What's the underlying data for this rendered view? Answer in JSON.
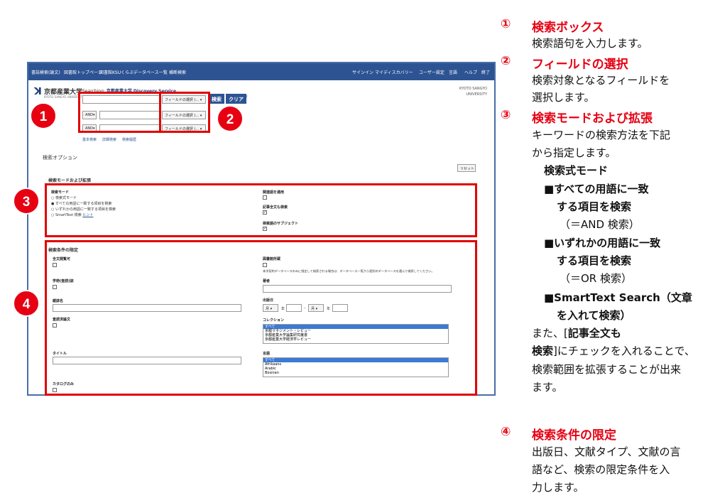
{
  "screenshot": {
    "nav": {
      "items": [
        "書誌検索(論文)",
        "図書館トップページ",
        "図書館KSUくらぶ",
        "データベース一覧",
        "横断検索"
      ],
      "right": [
        "サインイン",
        "マイディスカバリー",
        "ユーザー設定",
        "言語",
        "ヘルプ",
        "終了"
      ]
    },
    "header": {
      "logo": "京都産業大学",
      "logo_sub": "KYOTO SANGYO UNIVERSITY",
      "searching_prefix": "Searching:",
      "searching_target": "京都産業大学 Discovery Service",
      "kyoto_line1": "KYOTO SANGYO",
      "kyoto_line2": "UNIVERSITY"
    },
    "search": {
      "row2_op": "AND",
      "row3_op": "AND",
      "field_select_1": "フィールドの選択 (...",
      "field_select_2": "フィールドの選択 (...",
      "field_select_3": "フィールドの選択 (...",
      "search_button": "検索",
      "clear_button": "クリア",
      "help": "?",
      "link_basic": "基本検索",
      "link_detail": "詳細検索",
      "link_history": "検索履歴"
    },
    "options": {
      "title": "検索オプション",
      "reset": "リセット",
      "mode_section": "検索モードおよび拡張",
      "mode_label": "検索モード",
      "mode_items": [
        "検索式モード",
        "すべての用語に一致する項目を検索",
        "いずれかの用語に一致する項目を検索",
        "SmartText 検索"
      ],
      "mode_hint": "ヒント",
      "related_label": "関連語を適用",
      "fulltext_label": "記事全文も検索",
      "equiv_label": "検索語のサブジェクト",
      "limit_section": "検索条件の限定",
      "left_labels": [
        "全文閲覧可",
        "学術(查読)誌",
        "雑誌名",
        "査読済論文",
        "タイトル",
        "カタログのみ"
      ],
      "right_holdings": "図書館所蔵",
      "right_holdings_note": "本学契約データベースのみに限定して検索される場合は、データベース一覧から個別のデータベースを選んで検索してください。",
      "author_label": "著者",
      "pubdate_label": "出版日",
      "month": "月",
      "year_sep": "年",
      "collection_label": "コレクション",
      "collection_items": [
        "すべて",
        "京都マネジメント・レビュー",
        "京都産業大学論集研究叢書",
        "京都産業大学経済学レビュー"
      ],
      "language_label": "言語",
      "language_items": [
        "すべて",
        "Afrikaans",
        "Arabic",
        "Bosnian"
      ]
    }
  },
  "badges": [
    "1",
    "2",
    "3",
    "4"
  ],
  "notes": [
    {
      "num": "①",
      "title": "検索ボックス",
      "lines": [
        "検索語句を入力します。"
      ]
    },
    {
      "num": "②",
      "title": "フィールドの選択",
      "lines": [
        "検索対象となるフィールドを",
        "選択します。"
      ]
    },
    {
      "num": "③",
      "title": "検索モードおよび拡張",
      "lines": [
        "キーワードの検索方法を下記",
        "から指定します。"
      ]
    },
    {
      "num": "④",
      "title": "検索条件の限定",
      "lines": [
        "出版日、文献タイプ、文献の言",
        "語など、検索の限定条件を入",
        "力します。"
      ]
    }
  ],
  "mode_notes": {
    "heading": "検索式モード",
    "and1": "■すべての用語に一致",
    "and2": "する項目を検索",
    "and3": "（＝AND 検索）",
    "or1": "■いずれかの用語に一致",
    "or2": "する項目を検索",
    "or3": "（＝OR 検索）",
    "st1": "■SmartText Search（文章",
    "st2": "を入れて検索）",
    "also1a": "また、[",
    "also1b": "記事全文も",
    "also2a": "検索",
    "also2b": "]にチェックを入れることで、",
    "also3": "検索範囲を拡張することが出来",
    "also4": "ます。"
  },
  "colors": {
    "accent_red": "#e60012",
    "nav_blue": "#2d5393"
  }
}
